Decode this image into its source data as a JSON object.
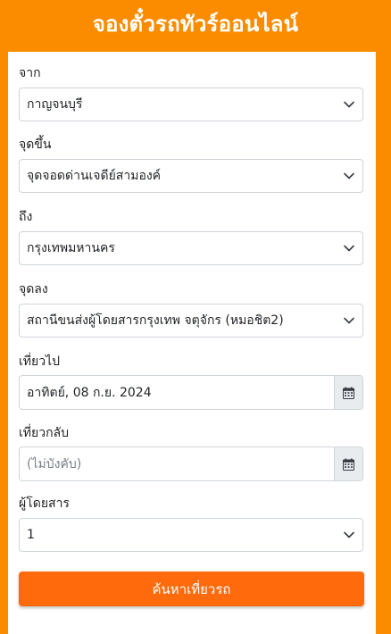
{
  "header": {
    "title": "จองตั๋วรถทัวร์ออนไลน์"
  },
  "form": {
    "from": {
      "label": "จาก",
      "value": "กาญจนบุรี"
    },
    "boarding": {
      "label": "จุดขึ้น",
      "value": "จุดจอดด่านเจดีย์สามองค์"
    },
    "to": {
      "label": "ถึง",
      "value": "กรุงเทพมหานคร"
    },
    "dropoff": {
      "label": "จุดลง",
      "value": "สถานีขนส่งผู้โดยสารกรุงเทพ จตุจักร (หมอชิต2)"
    },
    "depart": {
      "label": "เที่ยวไป",
      "value": "อาทิตย์, 08 ก.ย. 2024",
      "icon": "calendar-icon"
    },
    "return": {
      "label": "เที่ยวกลับ",
      "placeholder": "(ไม่บังคับ)",
      "icon": "calendar-icon"
    },
    "passengers": {
      "label": "ผู้โดยสาร",
      "value": "1"
    },
    "submit_label": "ค้นหาเที่ยวรถ"
  },
  "colors": {
    "background": "#fb8c00",
    "button": "#ff6a0d",
    "card": "#ffffff"
  }
}
